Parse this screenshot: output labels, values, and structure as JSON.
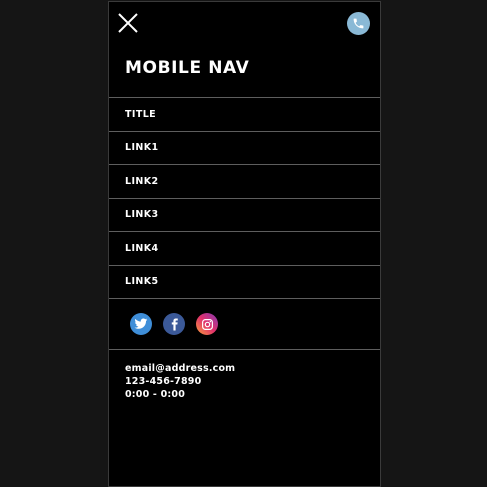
{
  "header": {
    "title": "MOBILE NAV"
  },
  "icons": {
    "close": "close-icon",
    "phone": "phone-icon"
  },
  "menu": [
    {
      "label": "TITLE"
    },
    {
      "label": "LINK1"
    },
    {
      "label": "LINK2"
    },
    {
      "label": "LINK3"
    },
    {
      "label": "LINK4"
    },
    {
      "label": "LINK5"
    }
  ],
  "social": [
    {
      "name": "twitter",
      "icon": "twitter-icon",
      "color": "#3f8ed8"
    },
    {
      "name": "facebook",
      "icon": "facebook-icon",
      "color": "#3b5998"
    },
    {
      "name": "instagram",
      "icon": "instagram-icon",
      "color": "#e1306c"
    }
  ],
  "contact": {
    "email": "email@address.com",
    "phone": "123-456-7890",
    "hours": "0:00 - 0:00"
  },
  "colors": {
    "background": "#151515",
    "panel": "#000000",
    "divider": "#5e5e5e",
    "phone_button": "#8ab9d6"
  }
}
